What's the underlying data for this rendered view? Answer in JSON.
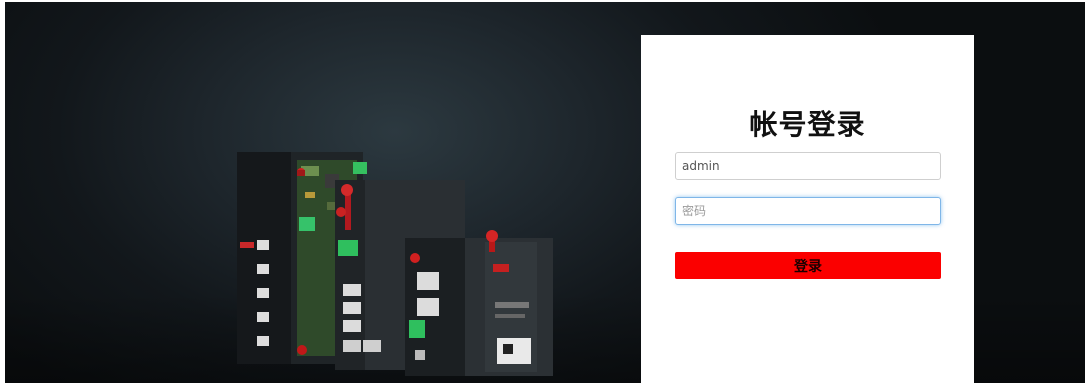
{
  "login": {
    "title": "帐号登录",
    "username_value": "admin",
    "username_placeholder": "",
    "password_value": "",
    "password_placeholder": "密码",
    "submit_label": "登录"
  },
  "colors": {
    "button": "#fb0000",
    "background": "#12171b",
    "card": "#ffffff"
  }
}
